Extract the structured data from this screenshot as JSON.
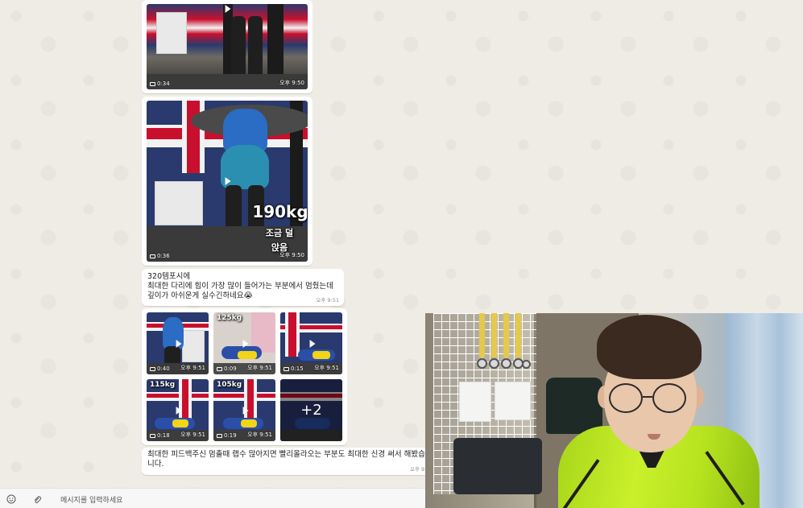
{
  "chat": {
    "media1": {
      "duration": "0:34",
      "time": "오후 9:50"
    },
    "media2": {
      "duration": "0:36",
      "time": "오후 9:50",
      "overlay_weight": "190kg",
      "overlay_line1": "조금 덜",
      "overlay_line2": "앉음"
    },
    "text1": {
      "lines": [
        "320템포시에",
        "최대한 다리에 힘이 가장 많이 들어가는 부분에서 멈췄는데",
        "깊이가 아쉬운게 실수긴하네요😭"
      ],
      "time": "오후 9:51"
    },
    "gallery": {
      "items": [
        {
          "duration": "0:40",
          "time": "오후 9:51",
          "label": ""
        },
        {
          "duration": "0:09",
          "time": "오후 9:51",
          "label": "125kg"
        },
        {
          "duration": "0:15",
          "time": "오후 9:51",
          "label": ""
        },
        {
          "duration": "0:18",
          "time": "오후 9:51",
          "label": "115kg"
        },
        {
          "duration": "0:19",
          "time": "오후 9:51",
          "label": "105kg"
        },
        {
          "duration": "",
          "time": "",
          "label": ""
        }
      ],
      "more_count": "+2"
    },
    "text2": {
      "lines": [
        "최대한 피드백주신 멈출때 랩수 많아지면 빨리올라오는 부분도 최대한 신경 써서 해봤습",
        "니다."
      ],
      "time": "오후 9"
    }
  },
  "composer": {
    "placeholder": "메시지를 입력하세요",
    "emoji_icon": "smile-icon",
    "attach_icon": "paperclip-icon"
  },
  "colors": {
    "chat_background": "#efece6",
    "bubble": "#ffffff",
    "jacket": "#c9f02b"
  }
}
